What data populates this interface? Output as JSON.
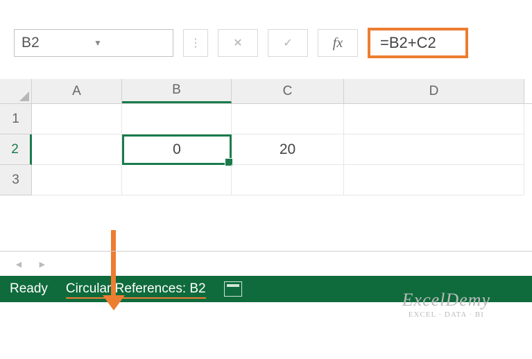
{
  "formula_bar": {
    "name_box": "B2",
    "dropdown_glyph": "▼",
    "sep_glyph": "⋮",
    "cancel_glyph": "✕",
    "enter_glyph": "✓",
    "fx_label": "fx",
    "formula": "=B2+C2"
  },
  "columns": {
    "A": "A",
    "B": "B",
    "C": "C",
    "D": "D"
  },
  "rows": {
    "r1": "1",
    "r2": "2",
    "r3": "3"
  },
  "cells": {
    "B2": "0",
    "C2": "20"
  },
  "sheet_nav": {
    "prev_glyph": "◄",
    "next_glyph": "►"
  },
  "status": {
    "ready": "Ready",
    "circ_ref": "Circular References: B2"
  },
  "watermark": {
    "brand": "ExcelDemy",
    "tag": "EXCEL · DATA · BI"
  },
  "colors": {
    "excel_green": "#0f6b3c",
    "accent_orange": "#ed7d31"
  }
}
